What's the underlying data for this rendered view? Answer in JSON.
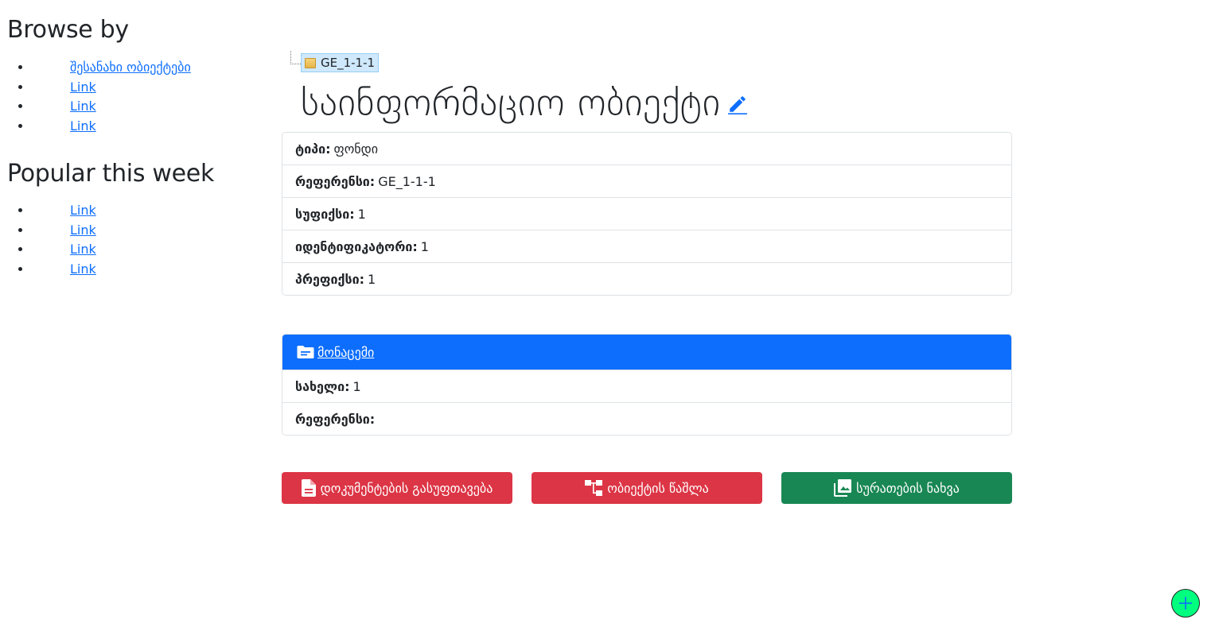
{
  "sidebar": {
    "browse_title": "Browse by",
    "browse_items": [
      {
        "label": "შესანახი ობიექტები"
      },
      {
        "label": "Link"
      },
      {
        "label": "Link"
      },
      {
        "label": "Link"
      }
    ],
    "popular_title": "Popular this week",
    "popular_items": [
      {
        "label": "Link"
      },
      {
        "label": "Link"
      },
      {
        "label": "Link"
      },
      {
        "label": "Link"
      }
    ]
  },
  "tree": {
    "node_label": "GE_1-1-1",
    "icon": "folder-icon"
  },
  "page": {
    "title": "საინფორმაციო ობიექტი",
    "edit_icon": "pencil-icon"
  },
  "info": [
    {
      "label": "ტიპი:",
      "value": "ფონდი"
    },
    {
      "label": "რეფერენსი:",
      "value": "GE_1-1-1"
    },
    {
      "label": "სუფიქსი:",
      "value": "1"
    },
    {
      "label": "იდენტიფიკატორი:",
      "value": "1"
    },
    {
      "label": "პრეფიქსი:",
      "value": "1"
    }
  ],
  "data_section": {
    "header": "მონაცემი",
    "icon": "folder-icon",
    "header_color": "#0d6efd",
    "rows": [
      {
        "label": "სახელი:",
        "value": "1"
      },
      {
        "label": "რეფერენსი:",
        "value": ""
      }
    ]
  },
  "actions": {
    "documents_label": "დოკუმენტების გასუფთავება",
    "split_label": "ობიექტის წაშლა",
    "images_label": "სურათების ნახვა",
    "danger_color": "#dc3545",
    "success_color": "#198754"
  },
  "fab": {
    "icon": "plus-icon",
    "color": "#00ff7f"
  }
}
